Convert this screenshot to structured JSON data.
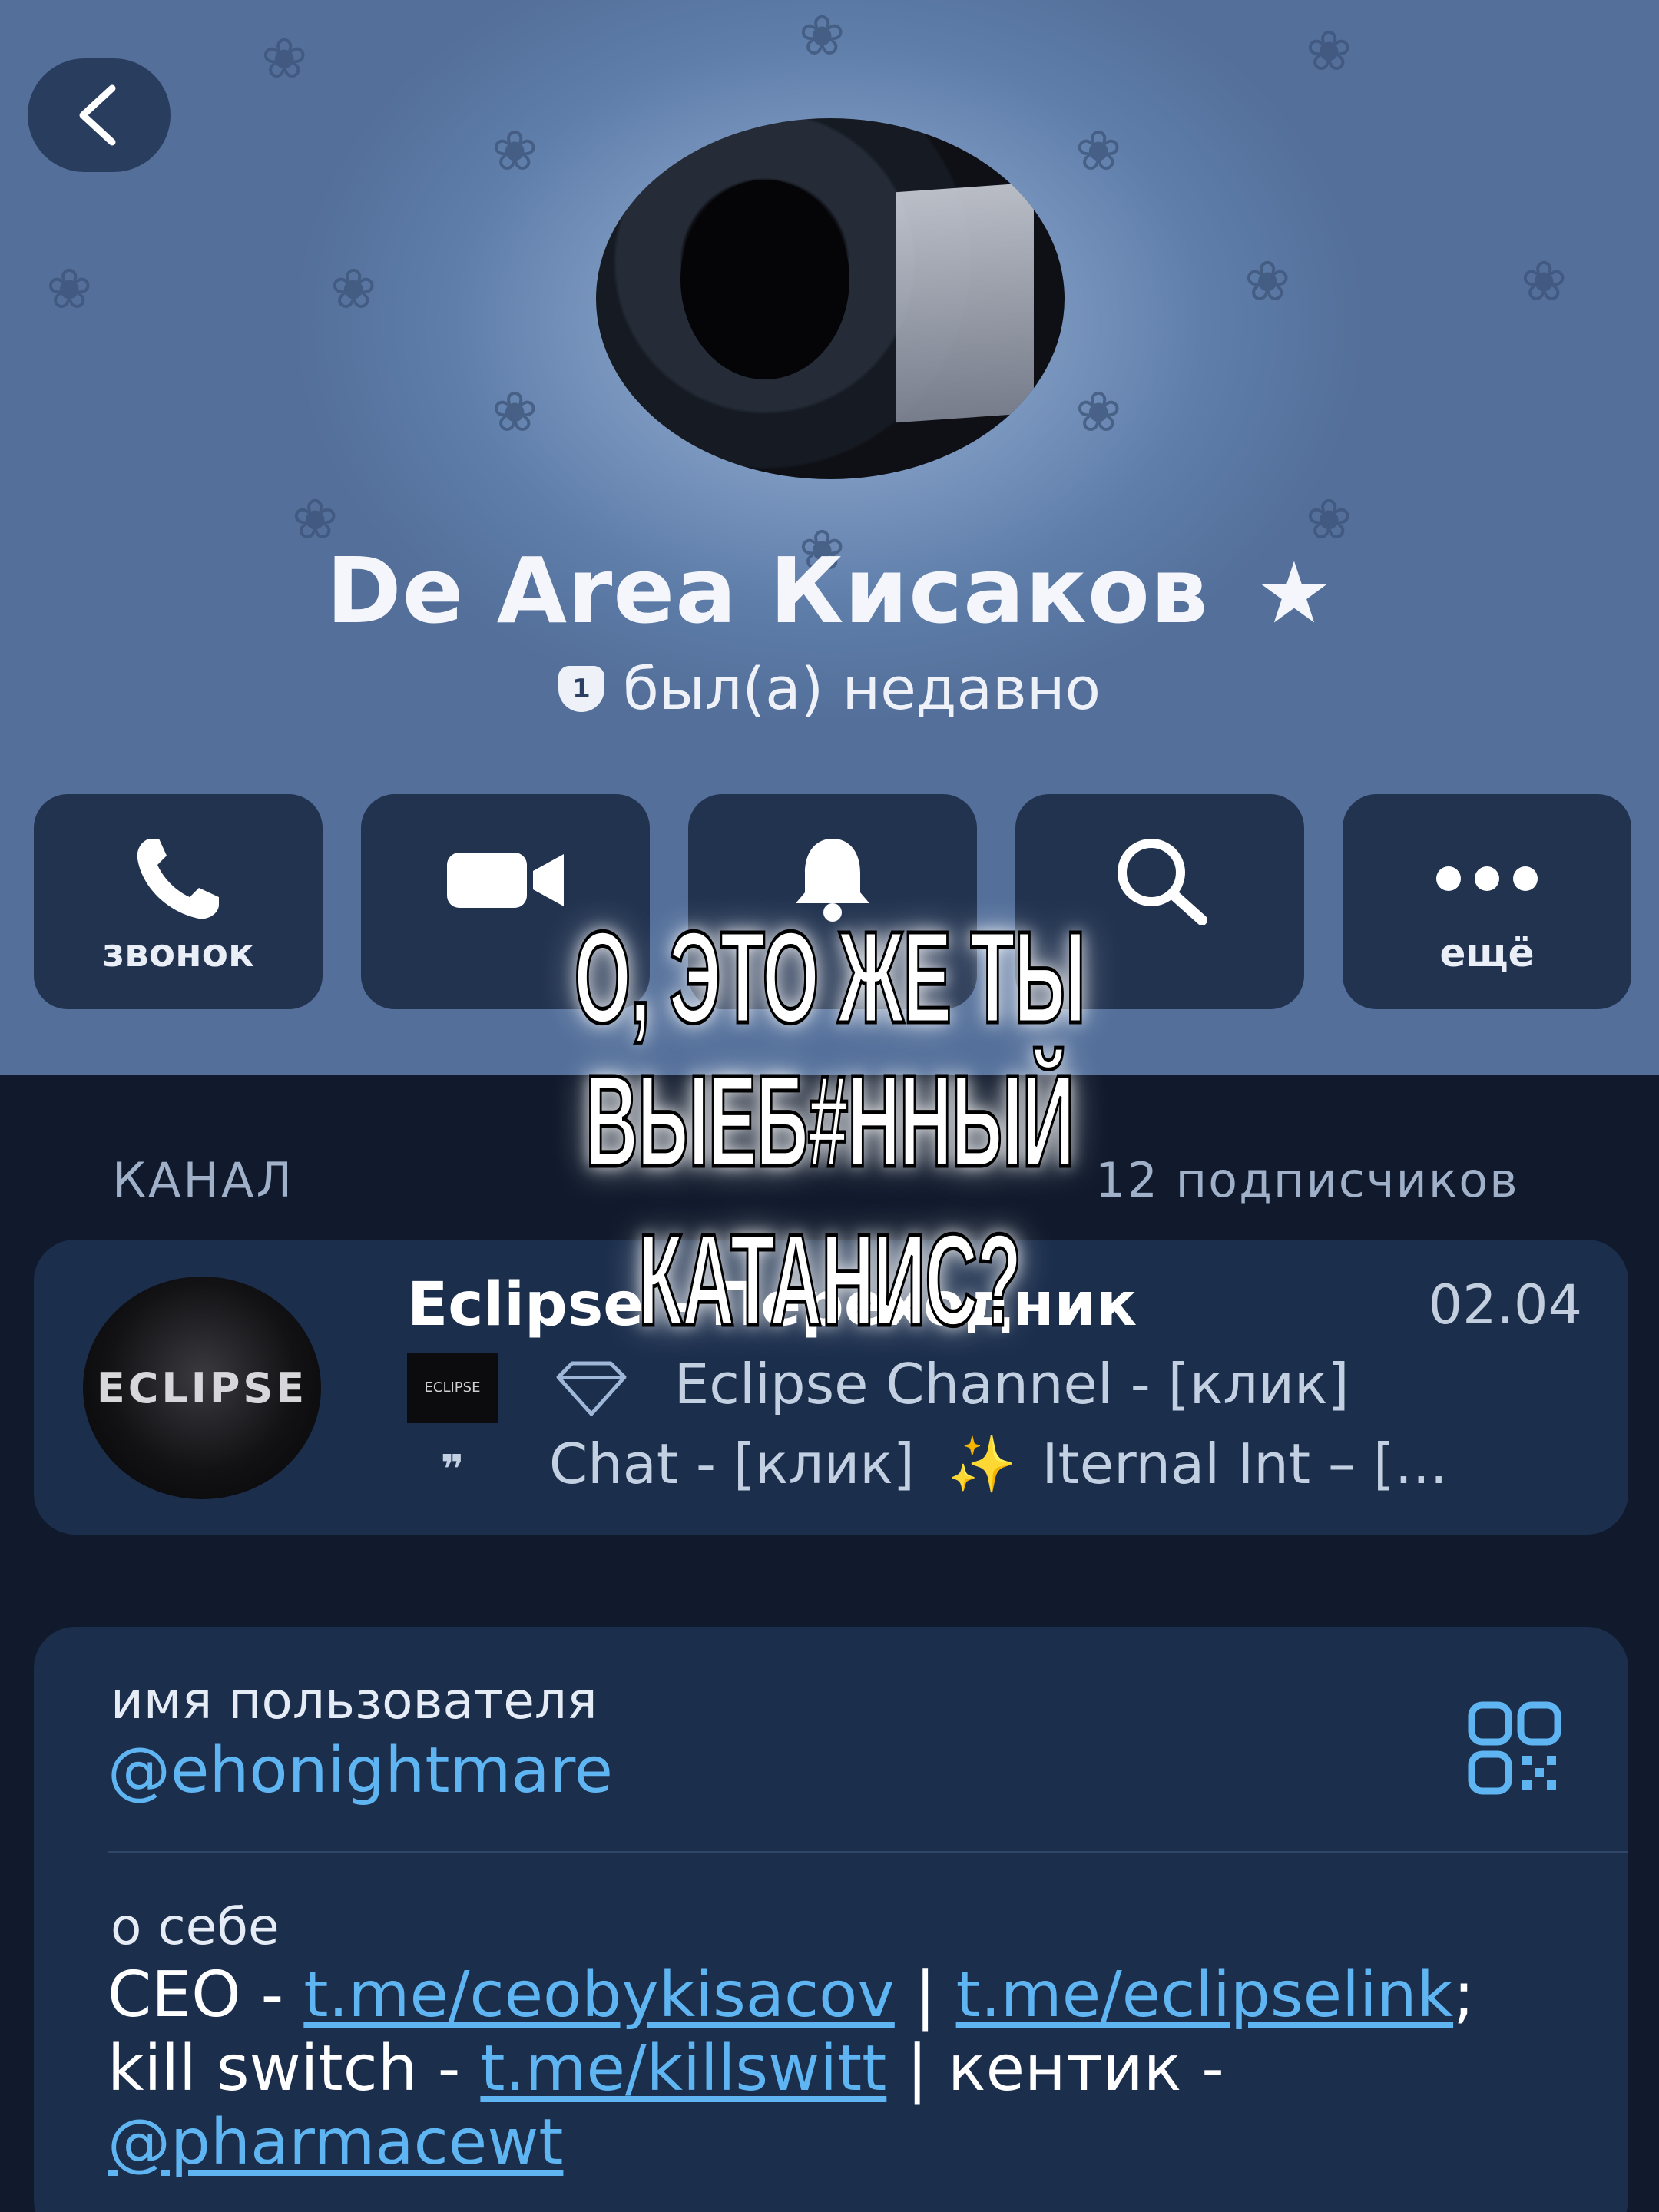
{
  "header": {
    "profile_name": "De Area Кисаков",
    "premium_star": "★",
    "status_badge": "1",
    "status_text": "был(а) недавно"
  },
  "actions": [
    {
      "label": "звонок",
      "icon": "phone-icon"
    },
    {
      "label": "",
      "icon": "video-icon"
    },
    {
      "label": "",
      "icon": "bell-icon"
    },
    {
      "label": "",
      "icon": "search-icon"
    },
    {
      "label": "ещё",
      "icon": "more-icon"
    }
  ],
  "overlay": {
    "line1": "О, ЭТО ЖЕ ТЫ ВЫЕБ#ННЫЙ",
    "line2": "КАТАНИС?"
  },
  "channel": {
    "section_label": "КАНАЛ",
    "subscribers": "12 подписчиков",
    "avatar_text": "ECLIPSE",
    "mini_logo_text": "ECLIPSE",
    "title": "Eclipse - Переходник",
    "date": "02.04",
    "line1": "Eclipse Channel - [клик]",
    "line2_a": "Chat - [клик]",
    "line2_b": "Iternal Int – [..."
  },
  "info": {
    "username_label": "имя пользователя",
    "username": "@ehonightmare",
    "bio_label": "о себе",
    "bio": {
      "p1": "CEO - ",
      "link1": "t.me/ceobykisacov",
      "p2": " | ",
      "link2": "t.me/eclipselink",
      "p3": "; kill switch - ",
      "link3": "t.me/killswitt",
      "p4": " | кентик - ",
      "link4": "@pharmacewt"
    }
  },
  "colors": {
    "background": "#101a2c",
    "card": "#1b2e4c",
    "link": "#5fb4f2"
  }
}
